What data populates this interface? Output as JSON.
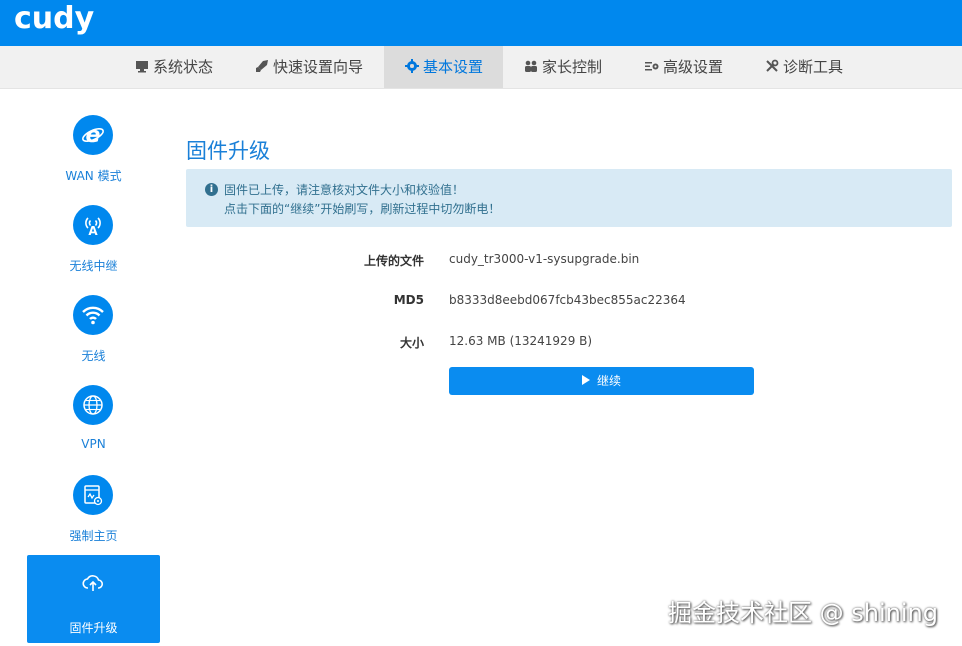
{
  "brand": {
    "logo": "cudy"
  },
  "nav": {
    "items": [
      {
        "label": "系统状态",
        "icon": "monitor-icon"
      },
      {
        "label": "快速设置向导",
        "icon": "rocket-icon"
      },
      {
        "label": "基本设置",
        "icon": "gear-icon"
      },
      {
        "label": "家长控制",
        "icon": "family-icon"
      },
      {
        "label": "高级设置",
        "icon": "advanced-settings-icon"
      },
      {
        "label": "诊断工具",
        "icon": "tools-icon"
      }
    ],
    "active": "基本设置"
  },
  "sidebar": {
    "items": [
      {
        "label": "WAN 模式",
        "icon": "internet-explorer-icon"
      },
      {
        "label": "无线中继",
        "icon": "wireless-repeater-icon"
      },
      {
        "label": "无线",
        "icon": "wifi-icon"
      },
      {
        "label": "VPN",
        "icon": "globe-icon"
      },
      {
        "label": "强制主页",
        "icon": "homepage-icon"
      },
      {
        "label": "固件升级",
        "icon": "cloud-upload-icon"
      }
    ],
    "active": "固件升级"
  },
  "main": {
    "title": "固件升级",
    "notice": {
      "line1": "固件已上传，请注意核对文件大小和校验值！",
      "line2": "点击下面的“继续”开始刷写，刷新过程中切勿断电！"
    },
    "fields": [
      {
        "label": "上传的文件",
        "value": "cudy_tr3000-v1-sysupgrade.bin"
      },
      {
        "label": "MD5",
        "value": "b8333d8eebd067fcb43bec855ac22364"
      },
      {
        "label": "大小",
        "value": "12.63 MB (13241929 B)"
      }
    ],
    "continue_label": "继续"
  },
  "watermark": "掘金技术社区 @ shining",
  "colors": {
    "brand_blue": "#0088ee",
    "notice_bg": "#d8eaf5",
    "notice_text": "#31708f"
  }
}
